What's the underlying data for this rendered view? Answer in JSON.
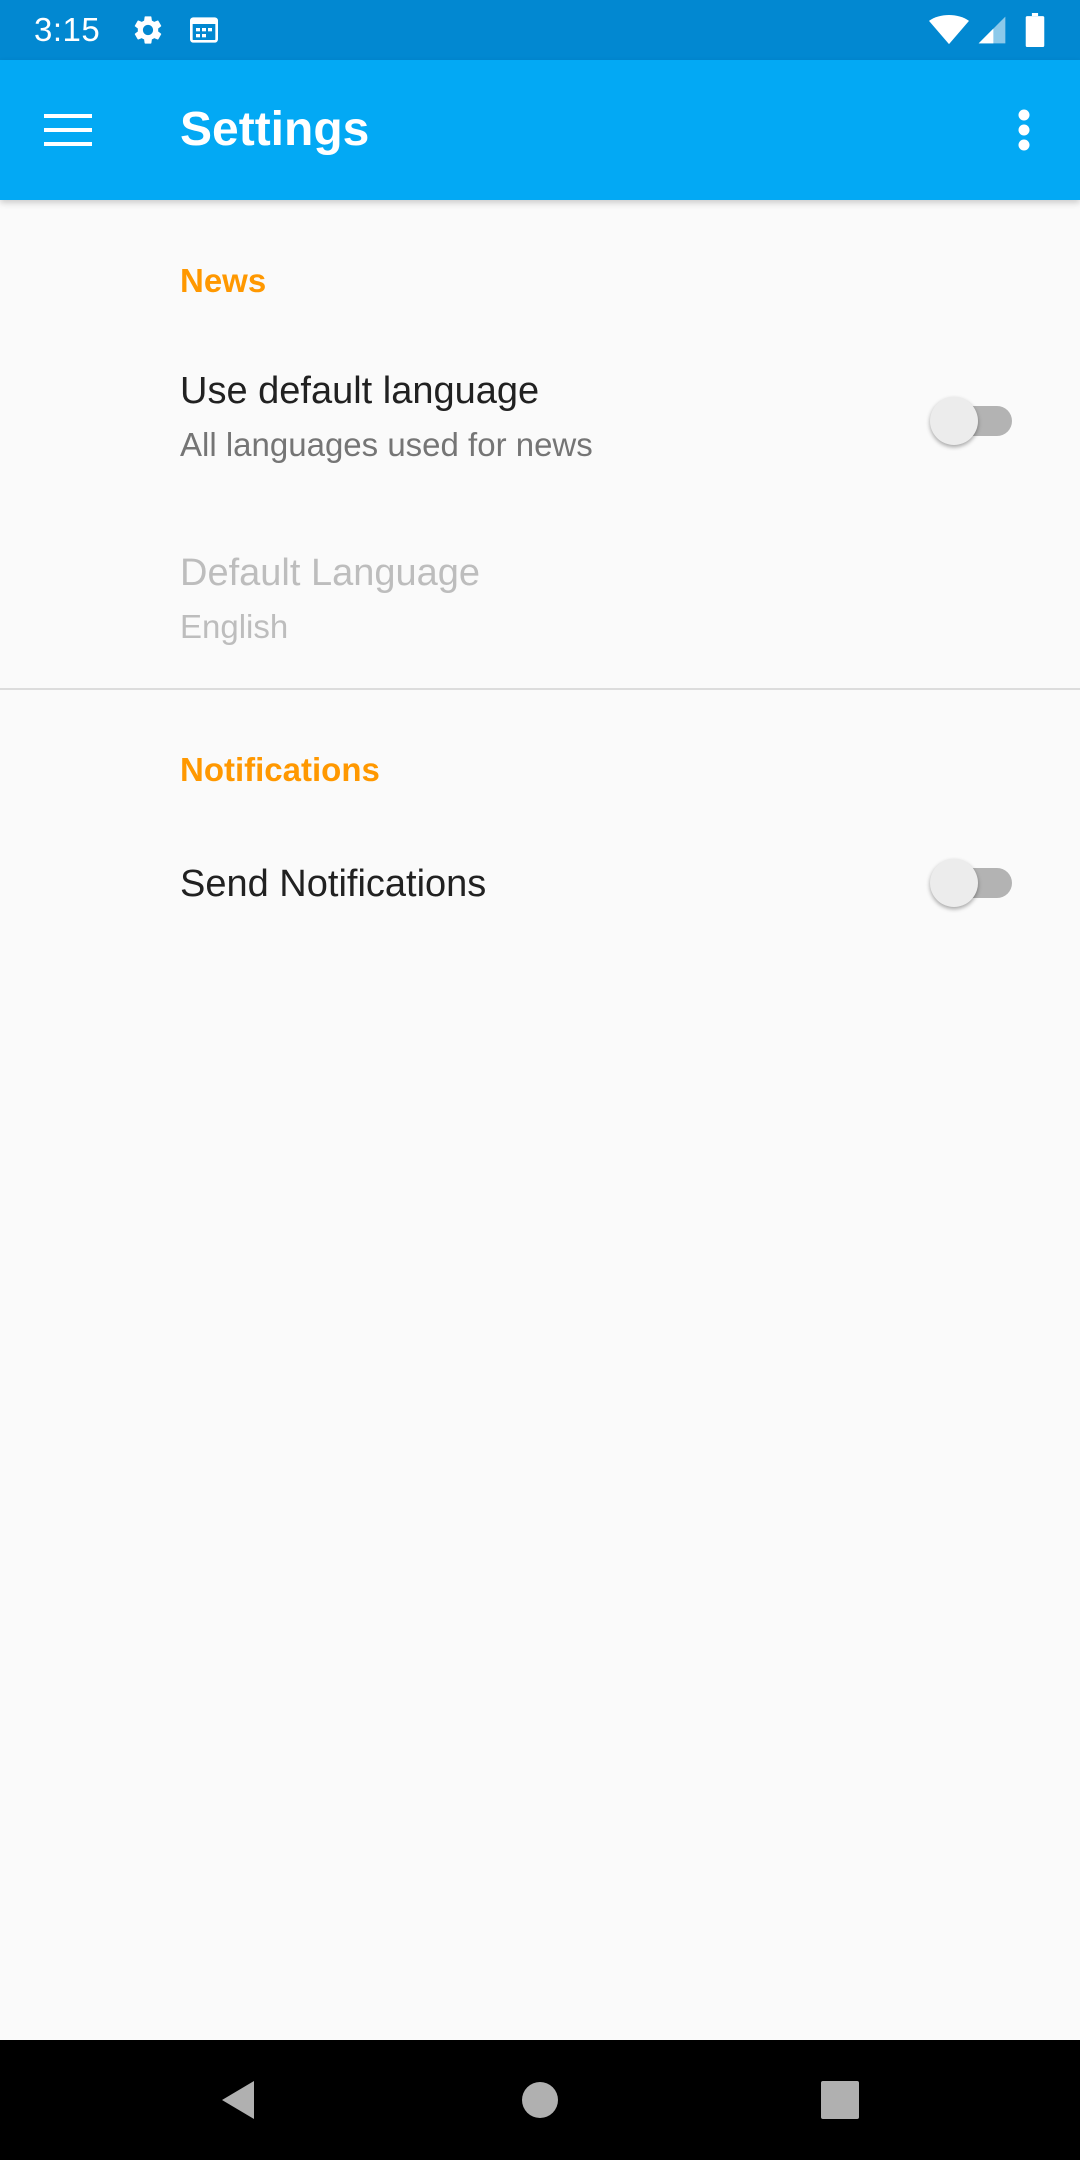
{
  "status_bar": {
    "time": "3:15",
    "left_icons": [
      "gear-icon",
      "calendar-icon"
    ],
    "right_icons": [
      "wifi-icon",
      "signal-icon",
      "battery-icon"
    ]
  },
  "app_bar": {
    "title": "Settings",
    "menu_icon": "hamburger-menu-icon",
    "overflow_icon": "more-vert-icon",
    "color": "#03a9f4",
    "status_color": "#0288d1"
  },
  "sections": {
    "news": {
      "header": "News",
      "use_default_language": {
        "title": "Use default language",
        "summary": "All languages used for news",
        "enabled": false
      },
      "default_language": {
        "title": "Default Language",
        "summary": "English",
        "disabled": true
      }
    },
    "notifications": {
      "header": "Notifications",
      "send_notifications": {
        "title": "Send Notifications",
        "enabled": false
      }
    }
  },
  "accent_color": "#ff9800",
  "nav_bar": {
    "buttons": [
      "back-icon",
      "home-icon",
      "recents-icon"
    ]
  }
}
